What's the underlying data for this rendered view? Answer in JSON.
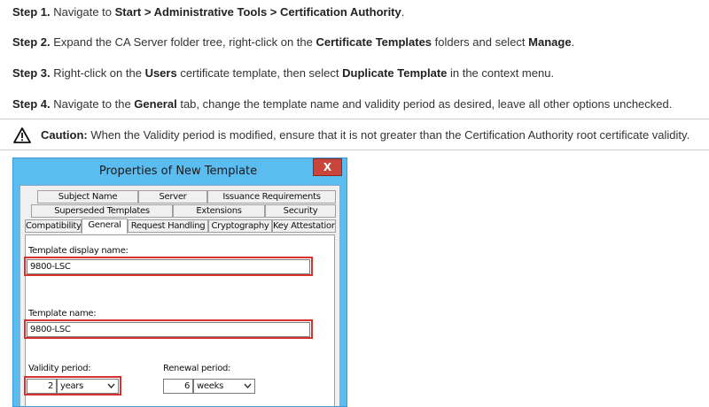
{
  "steps": [
    {
      "label": "Step 1.",
      "parts": [
        {
          "t": " Navigate to ",
          "b": false
        },
        {
          "t": "Start > Administrative Tools > Certification Authority",
          "b": true
        },
        {
          "t": ".",
          "b": false
        }
      ]
    },
    {
      "label": "Step 2.",
      "parts": [
        {
          "t": " Expand the CA Server folder tree, right-click on the ",
          "b": false
        },
        {
          "t": "Certificate Templates",
          "b": true
        },
        {
          "t": " folders and select ",
          "b": false
        },
        {
          "t": "Manage",
          "b": true
        },
        {
          "t": ".",
          "b": false
        }
      ]
    },
    {
      "label": "Step 3.",
      "parts": [
        {
          "t": " Right-click on the ",
          "b": false
        },
        {
          "t": "Users",
          "b": true
        },
        {
          "t": " certificate template, then select ",
          "b": false
        },
        {
          "t": "Duplicate Template",
          "b": true
        },
        {
          "t": " in the context menu.",
          "b": false
        }
      ]
    },
    {
      "label": "Step 4.",
      "parts": [
        {
          "t": " Navigate to the ",
          "b": false
        },
        {
          "t": "General",
          "b": true
        },
        {
          "t": " tab, change the template name and validity period as desired, leave all other options unchecked.",
          "b": false
        }
      ]
    }
  ],
  "caution": {
    "label": "Caution:",
    "text": " When the Validity period is modified, ensure that it is not greater than the Certification Authority root certificate validity.",
    "icon": "warning-triangle-icon"
  },
  "dialog": {
    "title": "Properties of New Template",
    "close_label": "X",
    "tabs": {
      "row1": [
        "Subject Name",
        "Server",
        "Issuance Requirements"
      ],
      "row2": [
        "Superseded Templates",
        "Extensions",
        "Security"
      ],
      "row3": [
        "Compatibility",
        "General",
        "Request Handling",
        "Cryptography",
        "Key Attestation"
      ]
    },
    "active_tab": "General",
    "display_name_label": "Template display name:",
    "display_name_value": "9800-LSC",
    "template_name_label": "Template name:",
    "template_name_value": "9800-LSC",
    "validity_label": "Validity period:",
    "validity_value": "2",
    "validity_unit": "years",
    "renewal_label": "Renewal period:",
    "renewal_value": "6",
    "renewal_unit": "weeks",
    "colors": {
      "highlight": "#d9312b",
      "titlebar": "#5bbcf0",
      "close": "#c9453b"
    }
  }
}
